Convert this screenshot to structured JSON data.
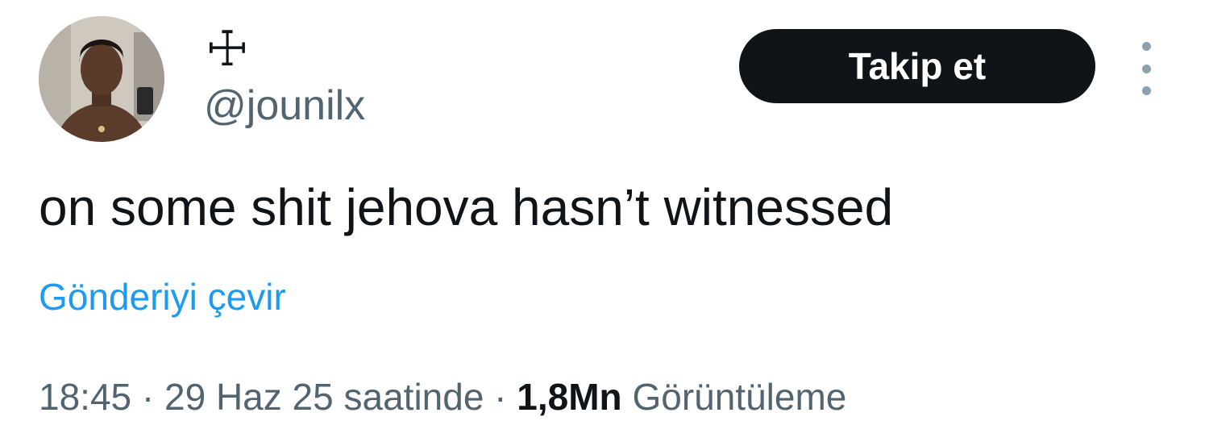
{
  "author": {
    "display_name": "☩",
    "handle": "@jounilx"
  },
  "actions": {
    "follow_label": "Takip et",
    "more_icon": "more-vertical-icon"
  },
  "post": {
    "text": "on some shit jehova hasn’t witnessed",
    "translate_label": "Gönderiyi çevir"
  },
  "meta": {
    "time": "18:45",
    "separator": " · ",
    "date": "29 Haz 25 saatinde",
    "views_count": "1,8Mn",
    "views_label": "Görüntüleme"
  },
  "colors": {
    "text": "#0f1419",
    "secondary": "#536471",
    "link": "#1d9bf0",
    "button": "#0f1419"
  }
}
